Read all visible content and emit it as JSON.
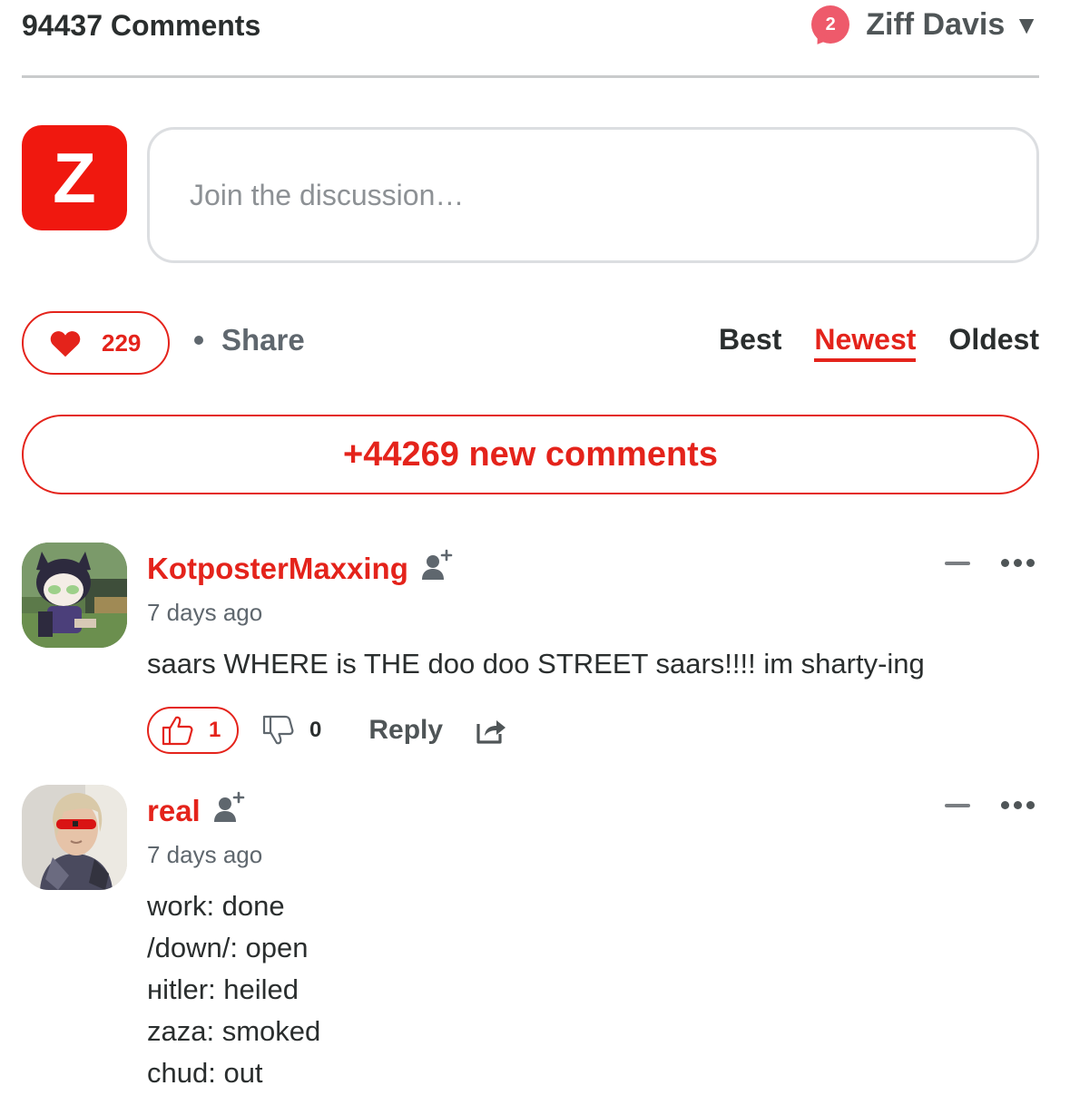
{
  "header": {
    "comment_count_title": "94437 Comments",
    "notification_count": "2",
    "account_name": "Ziff Davis"
  },
  "composer": {
    "avatar_letter": "Z",
    "placeholder": "Join the discussion…"
  },
  "actions": {
    "like_count": "229",
    "share_label": "Share"
  },
  "sort": {
    "tabs": [
      "Best",
      "Newest",
      "Oldest"
    ],
    "active": "Newest"
  },
  "new_comments_label": "+44269 new comments",
  "comments": [
    {
      "author": "KotposterMaxxing",
      "time": "7 days ago",
      "text": "saars WHERE is THE doo doo STREET saars!!!! im sharty-ing",
      "upvotes": "1",
      "downvotes": "0",
      "reply_label": "Reply"
    },
    {
      "author": "real",
      "time": "7 days ago",
      "text": "work: done\n/down/: open\nнitler: heiled\nzaza: smoked\nchud: out"
    }
  ],
  "colors": {
    "accent": "#e4231b",
    "brand_avatar": "#f0180f",
    "notification": "#ee5a6b",
    "divider": "#c9cbcc"
  }
}
